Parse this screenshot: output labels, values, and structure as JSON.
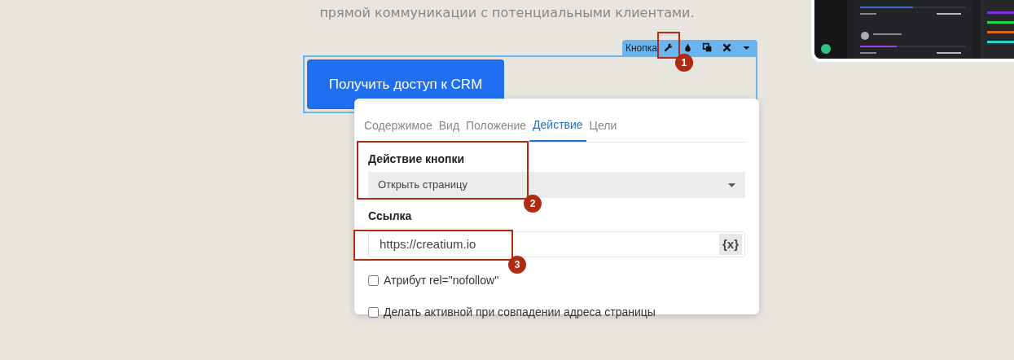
{
  "subtitle": "прямой коммуникации с потенциальными клиентами.",
  "cta_button": {
    "label": "Получить доступ к CRM"
  },
  "element_toolbar": {
    "label": "Кнопка",
    "tools": [
      {
        "kind": "wrench"
      },
      {
        "kind": "drop"
      },
      {
        "kind": "copy"
      },
      {
        "kind": "close"
      },
      {
        "kind": "caret"
      }
    ]
  },
  "settings_popup": {
    "tabs": [
      {
        "label": "Содержимое",
        "selected": false
      },
      {
        "label": "Вид",
        "selected": false
      },
      {
        "label": "Положение",
        "selected": false
      },
      {
        "label": "Действие",
        "selected": true
      },
      {
        "label": "Цели",
        "selected": false
      }
    ],
    "action_label": "Действие кнопки",
    "action_value": "Открыть страницу",
    "link_label": "Ссылка",
    "link_value": "https://creatium.io",
    "variable_button": "{x}",
    "checkboxes": [
      {
        "label": "Атрибут rel=\"nofollow\"",
        "checked": false
      },
      {
        "label": "Делать активной при совпадении адреса страницы",
        "checked": false
      }
    ]
  },
  "annotations": [
    {
      "number": "1"
    },
    {
      "number": "2"
    },
    {
      "number": "3"
    }
  ]
}
